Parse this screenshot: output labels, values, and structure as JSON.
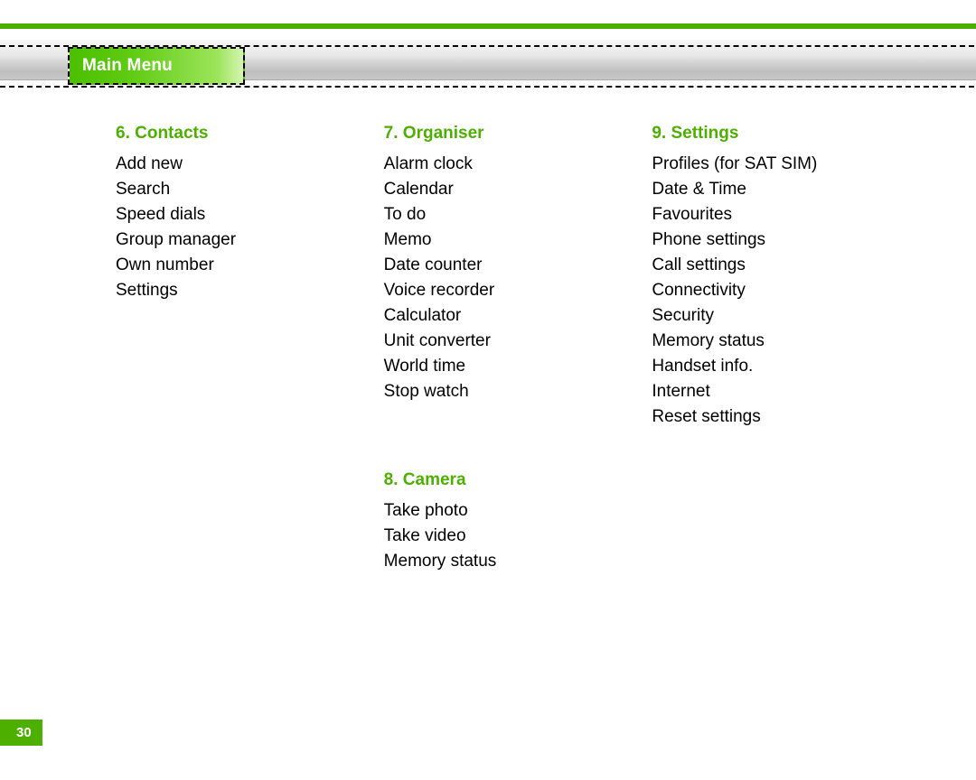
{
  "header": {
    "tab_label": "Main Menu"
  },
  "columns": [
    {
      "sections": [
        {
          "title": "6. Contacts",
          "items": [
            "Add new",
            "Search",
            "Speed dials",
            "Group manager",
            "Own number",
            "Settings"
          ]
        }
      ]
    },
    {
      "sections": [
        {
          "title": "7. Organiser",
          "items": [
            "Alarm clock",
            "Calendar",
            "To do",
            "Memo",
            "Date counter",
            "Voice recorder",
            "Calculator",
            "Unit converter",
            "World time",
            "Stop watch"
          ]
        },
        {
          "title": "8. Camera",
          "items": [
            "Take photo",
            "Take video",
            "Memory status"
          ]
        }
      ]
    },
    {
      "sections": [
        {
          "title": "9. Settings",
          "items": [
            "Profiles (for SAT SIM)",
            "Date & Time",
            "Favourites",
            "Phone settings",
            "Call settings",
            "Connectivity",
            "Security",
            "Memory status",
            "Handset info.",
            "Internet",
            "Reset settings"
          ]
        }
      ]
    }
  ],
  "page_number": "30"
}
